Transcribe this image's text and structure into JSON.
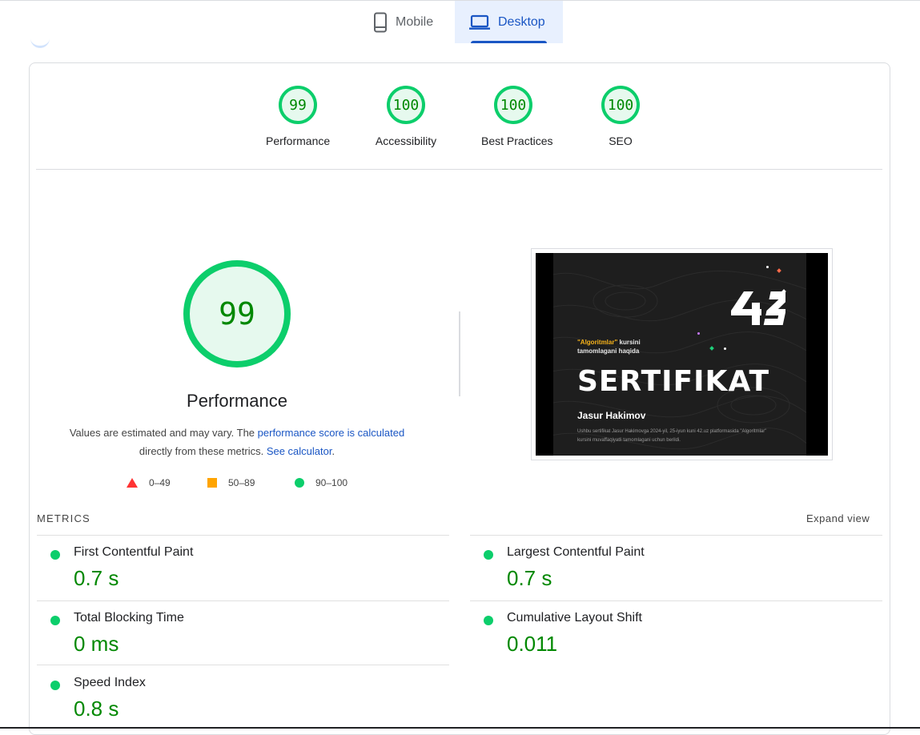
{
  "tabs": {
    "mobile": "Mobile",
    "desktop": "Desktop",
    "selected": "desktop"
  },
  "summary_gauges": [
    {
      "score": "99",
      "label": "Performance"
    },
    {
      "score": "100",
      "label": "Accessibility"
    },
    {
      "score": "100",
      "label": "Best Practices"
    },
    {
      "score": "100",
      "label": "SEO"
    }
  ],
  "performance": {
    "score": "99",
    "title": "Performance",
    "desc_prefix": "Values are estimated and may vary. The ",
    "desc_link": "performance score is calculated",
    "desc_mid": "directly from these metrics. ",
    "desc_link2": "See calculator",
    "desc_suffix": "."
  },
  "legend": {
    "fail": "0–49",
    "average": "50–89",
    "pass": "90–100"
  },
  "screenshot": {
    "subtitle_highlight": "\"Algoritmlar\"",
    "subtitle_rest": " kursini",
    "subtitle_line2": "tamomlagani haqida",
    "title": "SERTIFIKAT",
    "name": "Jasur Hakimov",
    "body": "Ushbu sertifikat Jasur Hakimovga 2024-yil, 25-iyun kuni 42.uz platformasida \"Algoritmlar\" kursini muvaffaqiyatli tamomlagani uchun berildi."
  },
  "metrics": {
    "label": "METRICS",
    "expand": "Expand view",
    "items": [
      {
        "name": "First Contentful Paint",
        "value": "0.7 s"
      },
      {
        "name": "Largest Contentful Paint",
        "value": "0.7 s"
      },
      {
        "name": "Total Blocking Time",
        "value": "0 ms"
      },
      {
        "name": "Cumulative Layout Shift",
        "value": "0.011"
      },
      {
        "name": "Speed Index",
        "value": "0.8 s"
      }
    ]
  },
  "colors": {
    "pass": "#0cce6b",
    "pass_text": "#008800",
    "average": "#ffa400",
    "fail": "#ff3333",
    "link": "#1a56c4",
    "tab_selected_bg": "#e8f0fe"
  }
}
